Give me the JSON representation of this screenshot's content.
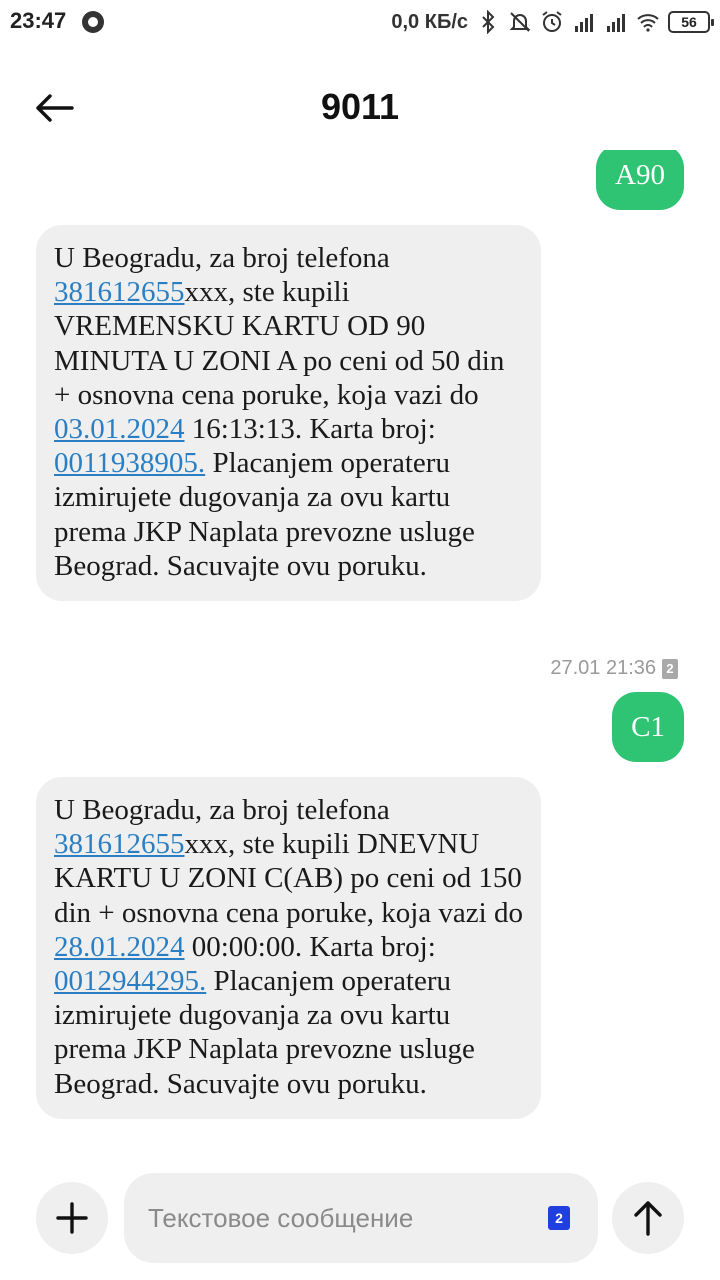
{
  "status_bar": {
    "time": "23:47",
    "net_speed": "0,0 КБ/с",
    "battery": "56",
    "icons": [
      "chrome-icon",
      "bluetooth-icon",
      "muted-bell-icon",
      "alarm-icon",
      "signal-icon",
      "signal-icon",
      "wifi-icon",
      "battery-icon"
    ]
  },
  "header": {
    "title": "9011",
    "back_icon": "back-arrow-icon"
  },
  "messages": [
    {
      "type": "sent",
      "text": "A90"
    },
    {
      "type": "received",
      "seg1": "U Beogradu, za broj telefona ",
      "phone": "381612655",
      "seg2": "xxx, ste kupili VREMENSKU KARTU OD 90 MINUTA U ZONI A po ceni od 50 din + osnovna cena poruke, koja vazi do ",
      "date": "03.01.2024",
      "seg3": " 16:13:13. Karta broj: ",
      "card": "0011938905.",
      "seg4": " Placanjem operateru izmirujete dugovanja za ovu kartu prema JKP Naplata prevozne usluge Beograd. Sacuvajte ovu poruku."
    },
    {
      "type": "timestamp",
      "text": "27.01 21:36",
      "sim": "2"
    },
    {
      "type": "sent",
      "text": "C1"
    },
    {
      "type": "received",
      "seg1": "U Beogradu, za broj telefona ",
      "phone": "381612655",
      "seg2": "xxx, ste kupili DNEVNU KARTU U ZONI C(AB) po ceni od 150 din + osnovna cena poruke, koja vazi do ",
      "date": "28.01.2024",
      "seg3": " 00:00:00. Karta broj: ",
      "card": "0012944295.",
      "seg4": " Placanjem operateru izmirujete dugovanja za ovu kartu prema JKP Naplata prevozne usluge Beograd. Sacuvajte ovu poruku."
    }
  ],
  "compose": {
    "placeholder": "Текстовое сообщение",
    "sim": "2",
    "add_icon": "plus-icon",
    "send_icon": "send-arrow-icon"
  },
  "colors": {
    "sent_bubble": "#2fc374",
    "received_bubble": "#efefef",
    "link": "#2a7fc4",
    "sim_badge": "#1f3fe0"
  }
}
